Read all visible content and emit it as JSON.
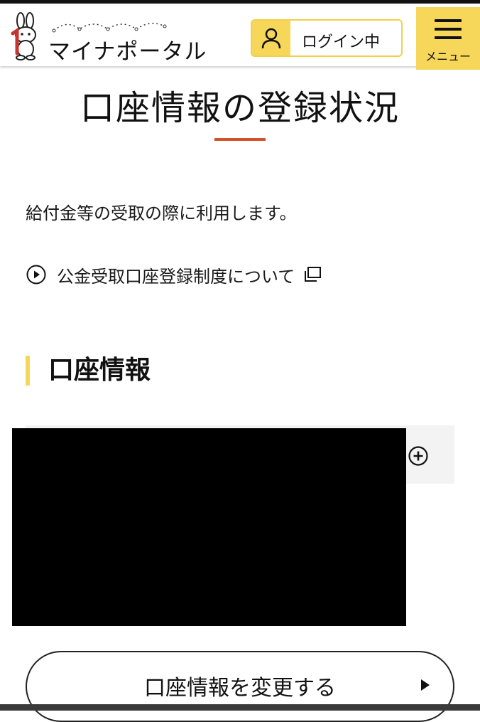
{
  "header": {
    "logo_text": "マイナポータル",
    "login_label": "ログイン中",
    "menu_label": "メニュー"
  },
  "page": {
    "title": "口座情報の登録状況",
    "description": "給付金等の受取の際に利用します。",
    "info_link": "公金受取口座登録制度について"
  },
  "section": {
    "heading": "口座情報"
  },
  "actions": {
    "change_button": "口座情報を変更する"
  },
  "colors": {
    "accent_yellow": "#f6d75a",
    "title_underline": "#d2522c",
    "accordion_bg": "#f3f3f3"
  },
  "icons": {
    "logo": "mascot-rabbit-icon",
    "login": "user-icon",
    "menu": "hamburger-icon",
    "link": "play-circle-icon",
    "external": "external-window-icon",
    "expand": "plus-circle-icon",
    "button_arrow": "triangle-right-icon"
  }
}
